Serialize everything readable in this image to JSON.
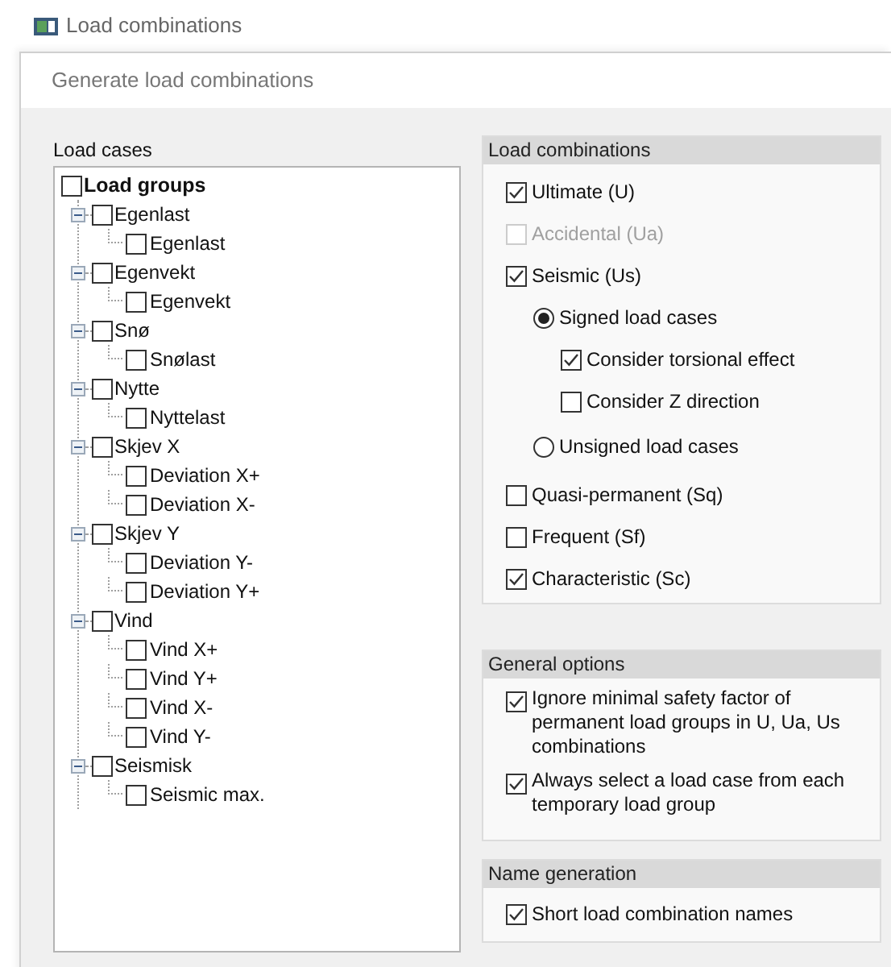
{
  "window": {
    "title": "Load combinations"
  },
  "dialog": {
    "title": "Generate load combinations"
  },
  "load_cases": {
    "label": "Load cases",
    "root": {
      "label": "Load groups",
      "checked": false,
      "children": [
        {
          "label": "Egenlast",
          "checked": false,
          "expanded": true,
          "children": [
            {
              "label": "Egenlast",
              "checked": false
            }
          ]
        },
        {
          "label": "Egenvekt",
          "checked": false,
          "expanded": true,
          "children": [
            {
              "label": "Egenvekt",
              "checked": false
            }
          ]
        },
        {
          "label": "Snø",
          "checked": false,
          "expanded": true,
          "children": [
            {
              "label": "Snølast",
              "checked": false
            }
          ]
        },
        {
          "label": "Nytte",
          "checked": false,
          "expanded": true,
          "children": [
            {
              "label": "Nyttelast",
              "checked": false
            }
          ]
        },
        {
          "label": "Skjev X",
          "checked": false,
          "expanded": true,
          "children": [
            {
              "label": "Deviation X+",
              "checked": false
            },
            {
              "label": "Deviation X-",
              "checked": false
            }
          ]
        },
        {
          "label": "Skjev Y",
          "checked": false,
          "expanded": true,
          "children": [
            {
              "label": "Deviation Y-",
              "checked": false
            },
            {
              "label": "Deviation Y+",
              "checked": false
            }
          ]
        },
        {
          "label": "Vind",
          "checked": false,
          "expanded": true,
          "children": [
            {
              "label": "Vind X+",
              "checked": false
            },
            {
              "label": "Vind Y+",
              "checked": false
            },
            {
              "label": "Vind X-",
              "checked": false
            },
            {
              "label": "Vind Y-",
              "checked": false
            }
          ]
        },
        {
          "label": "Seismisk",
          "checked": false,
          "expanded": true,
          "children": [
            {
              "label": "Seismic max.",
              "checked": false
            }
          ]
        }
      ]
    }
  },
  "load_combinations": {
    "title": "Load combinations",
    "options": [
      {
        "kind": "checkbox",
        "label": "Ultimate (U)",
        "checked": true,
        "disabled": false
      },
      {
        "kind": "checkbox",
        "label": "Accidental (Ua)",
        "checked": false,
        "disabled": true
      },
      {
        "kind": "checkbox",
        "label": "Seismic (Us)",
        "checked": true,
        "disabled": false,
        "children": [
          {
            "kind": "radio",
            "label": "Signed load cases",
            "selected": true,
            "children": [
              {
                "kind": "checkbox",
                "label": "Consider torsional effect",
                "checked": true,
                "disabled": false
              },
              {
                "kind": "checkbox",
                "label": "Consider Z direction",
                "checked": false,
                "disabled": false
              }
            ]
          },
          {
            "kind": "radio",
            "label": "Unsigned load cases",
            "selected": false
          }
        ]
      },
      {
        "kind": "checkbox",
        "label": "Quasi-permanent (Sq)",
        "checked": false,
        "disabled": false
      },
      {
        "kind": "checkbox",
        "label": "Frequent (Sf)",
        "checked": false,
        "disabled": false
      },
      {
        "kind": "checkbox",
        "label": "Characteristic (Sc)",
        "checked": true,
        "disabled": false
      }
    ]
  },
  "general_options": {
    "title": "General options",
    "options": [
      {
        "label": "Ignore minimal safety factor of permanent load groups in U, Ua, Us combinations",
        "checked": true
      },
      {
        "label": "Always select a load case from each temporary load group",
        "checked": true
      }
    ]
  },
  "name_generation": {
    "title": "Name generation",
    "options": [
      {
        "label": "Short load combination names",
        "checked": true
      }
    ]
  }
}
